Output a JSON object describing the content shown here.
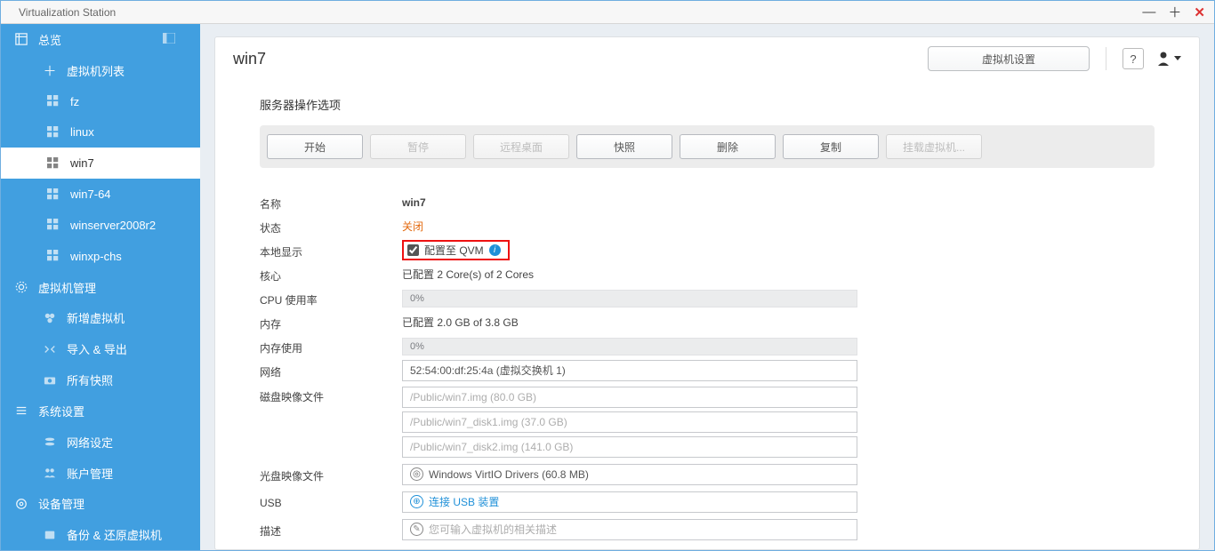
{
  "window": {
    "title": "Virtualization Station"
  },
  "sidebar": {
    "overview": "总览",
    "vm_list": "虚拟机列表",
    "vms": {
      "fz": "fz",
      "linux": "linux",
      "win7": "win7",
      "win7_64": "win7-64",
      "winserver": "winserver2008r2",
      "winxp": "winxp-chs"
    },
    "vm_manage": "虚拟机管理",
    "new_vm": "新增虚拟机",
    "import_export": "导入 & 导出",
    "all_snapshots": "所有快照",
    "sys_settings": "系统设置",
    "net_settings": "网络设定",
    "account_mgmt": "账户管理",
    "device_mgmt": "设备管理",
    "backup_restore": "备份 & 还原虚拟机"
  },
  "header": {
    "title": "win7",
    "settings_btn": "虚拟机设置"
  },
  "actions": {
    "section": "服务器操作选项",
    "start": "开始",
    "pause": "暂停",
    "remote": "远程桌面",
    "snapshot": "快照",
    "delete": "删除",
    "clone": "复制",
    "mount": "挂载虚拟机..."
  },
  "info": {
    "name_label": "名称",
    "name_value": "win7",
    "status_label": "状态",
    "status_value": "关闭",
    "local_display_label": "本地显示",
    "qvm_label": "配置至 QVM",
    "cores_label": "核心",
    "cores_value": "已配置 2 Core(s) of 2 Cores",
    "cpu_label": "CPU 使用率",
    "cpu_value": "0%",
    "mem_label": "内存",
    "mem_value": "已配置 2.0 GB of 3.8 GB",
    "memuse_label": "内存使用",
    "memuse_value": "0%",
    "net_label": "网络",
    "net_value": "52:54:00:df:25:4a (虚拟交换机 1)",
    "disk_label": "磁盘映像文件",
    "disk1": "/Public/win7.img (80.0 GB)",
    "disk2": "/Public/win7_disk1.img (37.0 GB)",
    "disk3": "/Public/win7_disk2.img (141.0 GB)",
    "cd_label": "光盘映像文件",
    "cd_value": "Windows VirtIO Drivers (60.8 MB)",
    "usb_label": "USB",
    "usb_value": "连接 USB 装置",
    "desc_label": "描述",
    "desc_placeholder": "您可输入虚拟机的相关描述"
  }
}
